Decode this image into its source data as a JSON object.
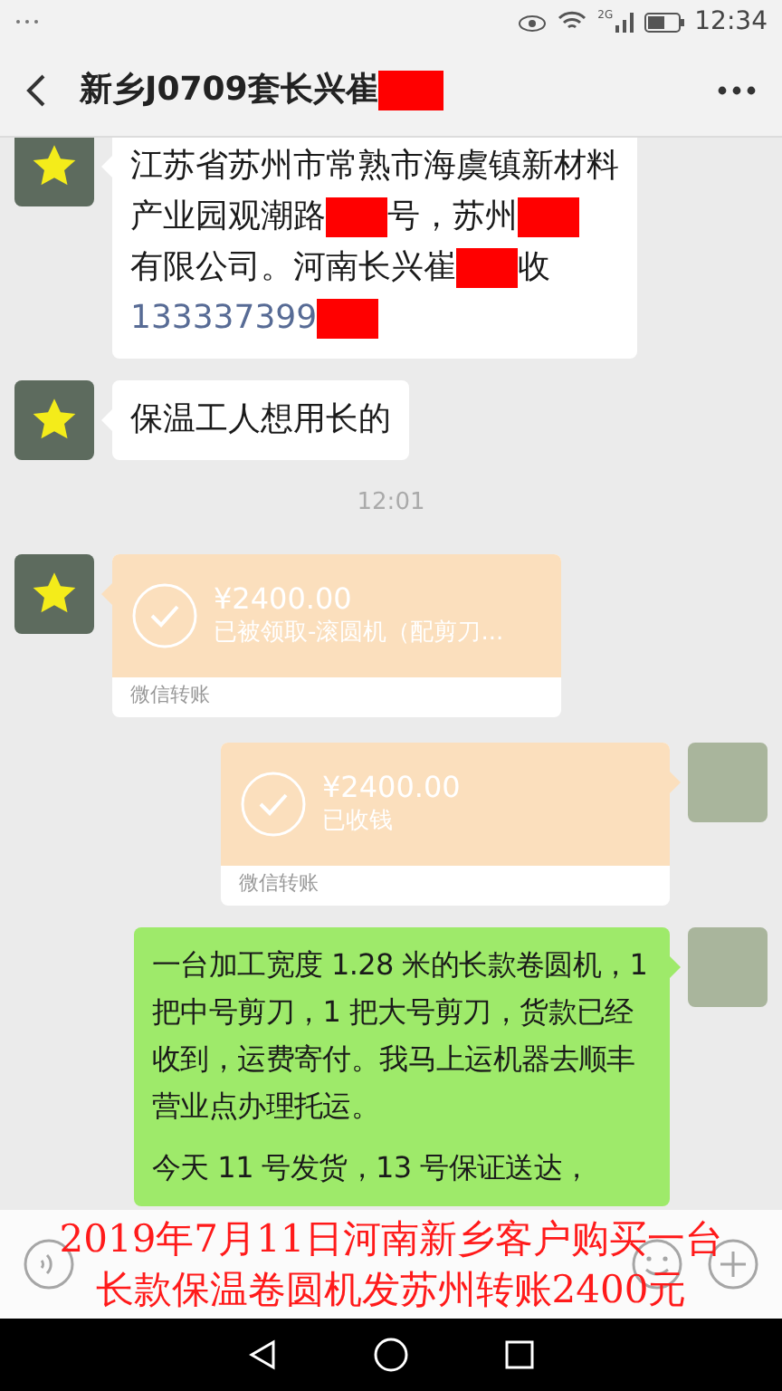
{
  "status_bar": {
    "time": "12:34",
    "network": "2G"
  },
  "header": {
    "title": "新乡J0709套长兴崔",
    "title_redacted": true
  },
  "messages": [
    {
      "kind": "text",
      "outgoing": false,
      "lines": [
        [
          {
            "kind": "text",
            "text": "江苏省苏州市常熟市海虞镇新材料"
          }
        ],
        [
          {
            "kind": "text",
            "text": "产业园观潮路"
          },
          {
            "kind": "redaction"
          },
          {
            "kind": "text",
            "text": "号，苏州"
          },
          {
            "kind": "redaction"
          }
        ],
        [
          {
            "kind": "text",
            "text": "有限公司。河南长兴崔"
          },
          {
            "kind": "redaction"
          },
          {
            "kind": "text",
            "text": "收"
          }
        ],
        [
          {
            "kind": "link",
            "text": "133337399"
          },
          {
            "kind": "redaction"
          }
        ]
      ]
    },
    {
      "kind": "text",
      "outgoing": false,
      "lines": [
        [
          {
            "kind": "text",
            "text": "保温工人想用长的"
          }
        ]
      ]
    },
    {
      "kind": "time",
      "text": "12:01"
    },
    {
      "kind": "transfer",
      "outgoing": false,
      "amount": "¥2400.00",
      "note": "已被领取-滚圆机（配剪刀...",
      "footer": "微信转账"
    },
    {
      "kind": "transfer",
      "outgoing": true,
      "amount": "¥2400.00",
      "note": "已收钱",
      "footer": "微信转账"
    },
    {
      "kind": "text",
      "outgoing": true,
      "lines": [
        [
          {
            "kind": "text",
            "text": "一台加工宽度 1.28 米的长款卷圆机，1 把中号剪刀，1 把大号剪刀，货款已经收到，运费寄付。我马上运机器去顺丰营业点办理托运。"
          }
        ],
        [
          {
            "kind": "text",
            "text": "今天 11 号发货，13 号保证送达，"
          }
        ]
      ]
    }
  ],
  "caption": [
    "2019年7月11日河南新乡客户购买一台",
    "长款保温卷圆机发苏州转账2400元"
  ]
}
